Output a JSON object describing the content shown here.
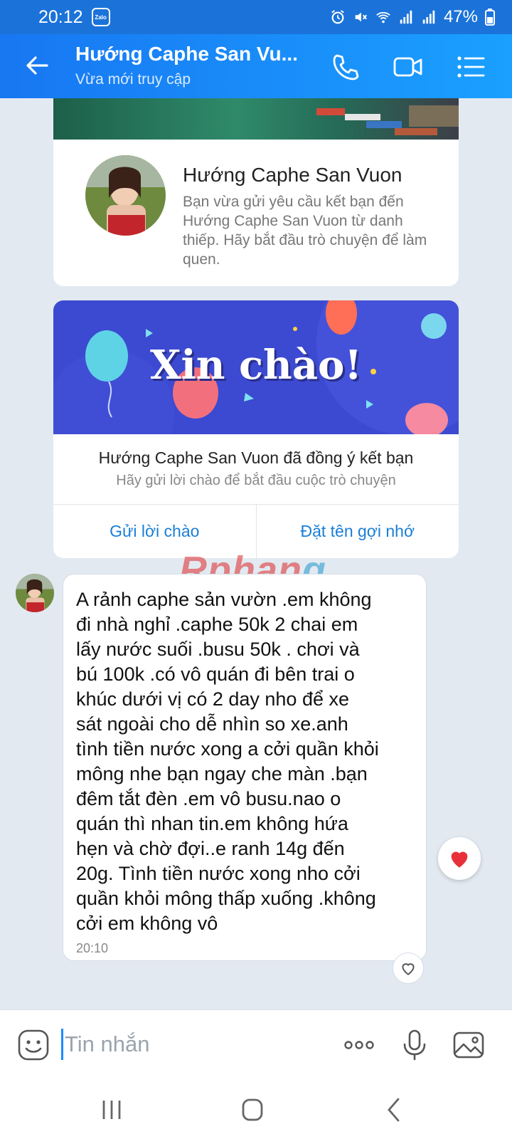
{
  "status_bar": {
    "time": "20:12",
    "app_badge": "Zalo",
    "battery": "47%"
  },
  "header": {
    "title": "Hướng Caphe San Vu...",
    "subtitle": "Vừa mới truy cập"
  },
  "profile_card": {
    "name": "Hướng Caphe San Vuon",
    "description": "Bạn vừa gửi yêu cầu kết bạn đến Hướng Caphe San Vuon từ danh thiếp. Hãy bắt đầu trò chuyện để làm quen."
  },
  "friend_card": {
    "hero_text": "Xin chào!",
    "title": "Hướng Caphe San Vuon đã đồng ý kết bạn",
    "subtitle": "Hãy gửi lời chào để bắt đầu cuộc trò chuyện",
    "actions": {
      "send_greeting": "Gửi lời chào",
      "set_nickname": "Đặt tên gợi nhớ"
    }
  },
  "watermark": {
    "part1": "Rphan",
    "part2": "g"
  },
  "message": {
    "text": "A rảnh caphe sản vườn .em không\nđi nhà nghỉ .caphe 50k 2 chai em\nlấy nước suối .busu 50k . chơi  và\nbú 100k .có vô quán đi bên trai o\nkhúc dưới vị có 2 day nho để xe\nsát ngoài cho dễ nhìn so xe.anh\ntình tiền nước xong a cởi quần khỏi\nmông nhe bạn ngay che màn .bạn\nđêm tắt đèn .em vô busu.nao o\nquán thì nhan tin.em không hứa\nhẹn  và chờ đợi..e ranh 14g đến\n20g. Tình tiền nước xong nho cởi\nquần khỏi mông thấp xuống .không\ncởi em không vô",
    "time": "20:10",
    "reaction": "heart"
  },
  "input": {
    "placeholder": "Tin nhắn"
  },
  "colors": {
    "header": "#1a8cff",
    "accent": "#1a7fd6",
    "heart": "#e8303a"
  }
}
